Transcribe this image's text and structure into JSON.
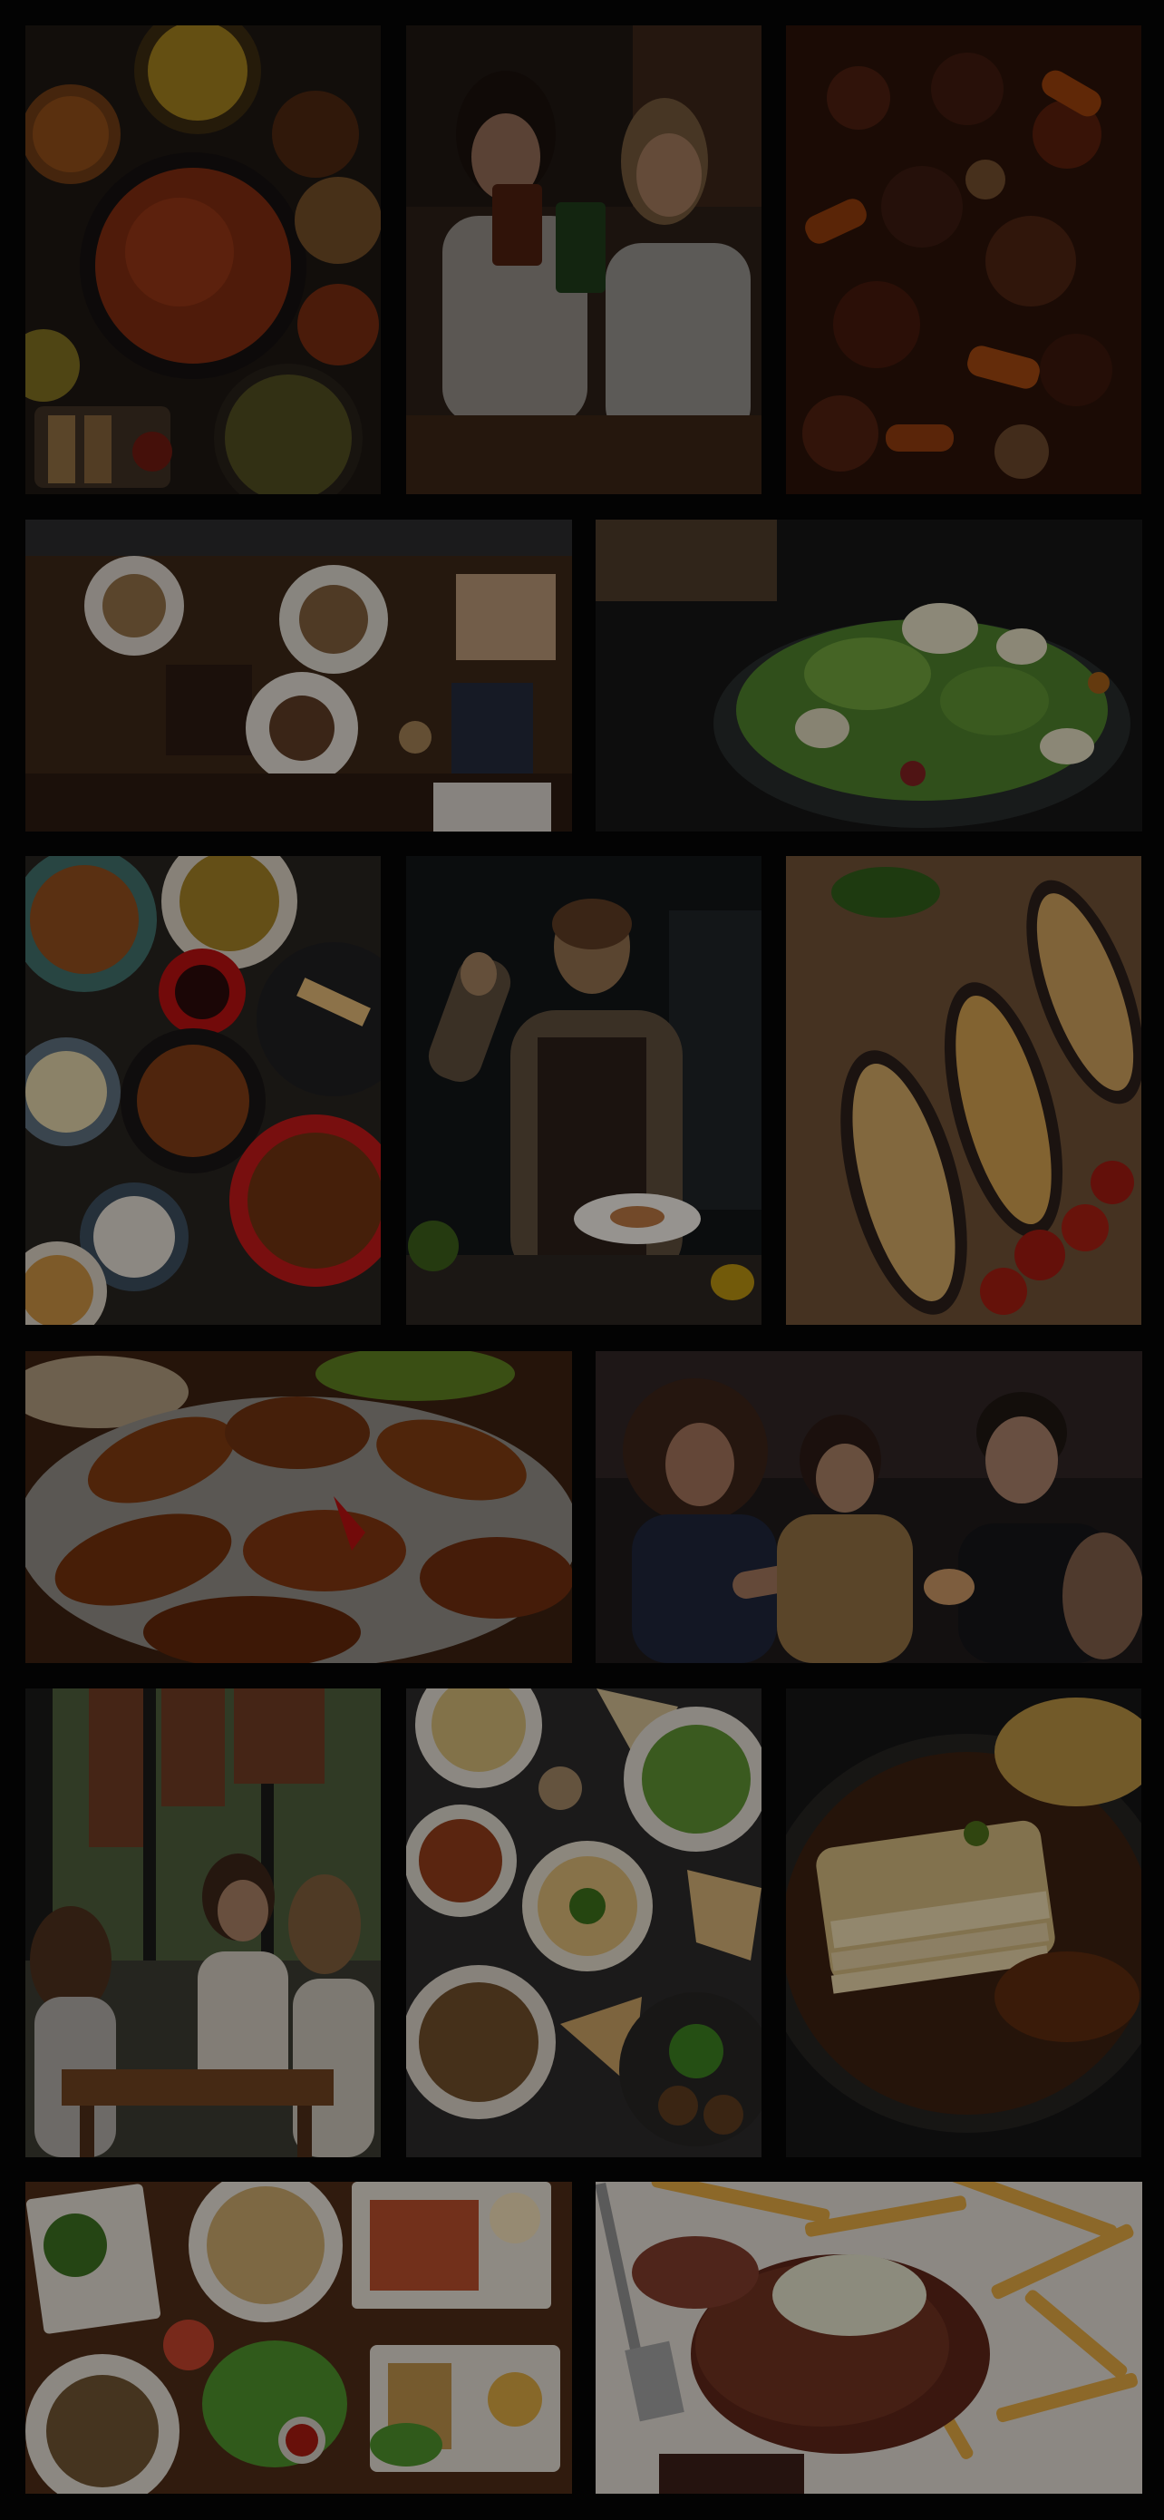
{
  "gallery": {
    "tiles": [
      {
        "subject": "curry-spread-photo"
      },
      {
        "subject": "friends-drinks-photo"
      },
      {
        "subject": "beef-stew-photo"
      },
      {
        "subject": "table-sharing-photo"
      },
      {
        "subject": "salad-photo"
      },
      {
        "subject": "asian-dishes-photo"
      },
      {
        "subject": "chef-plate-photo"
      },
      {
        "subject": "stuffed-eggplant-photo"
      },
      {
        "subject": "grilled-chicken-wings-photo"
      },
      {
        "subject": "friends-feeding-photo"
      },
      {
        "subject": "women-cafe-photo"
      },
      {
        "subject": "mezze-spread-photo"
      },
      {
        "subject": "potato-gratin-photo"
      },
      {
        "subject": "vietnamese-table-photo"
      },
      {
        "subject": "steak-fries-photo"
      }
    ],
    "colors": {
      "background": "#030303",
      "overlay": "rgba(0,0,0,0.35)"
    }
  }
}
